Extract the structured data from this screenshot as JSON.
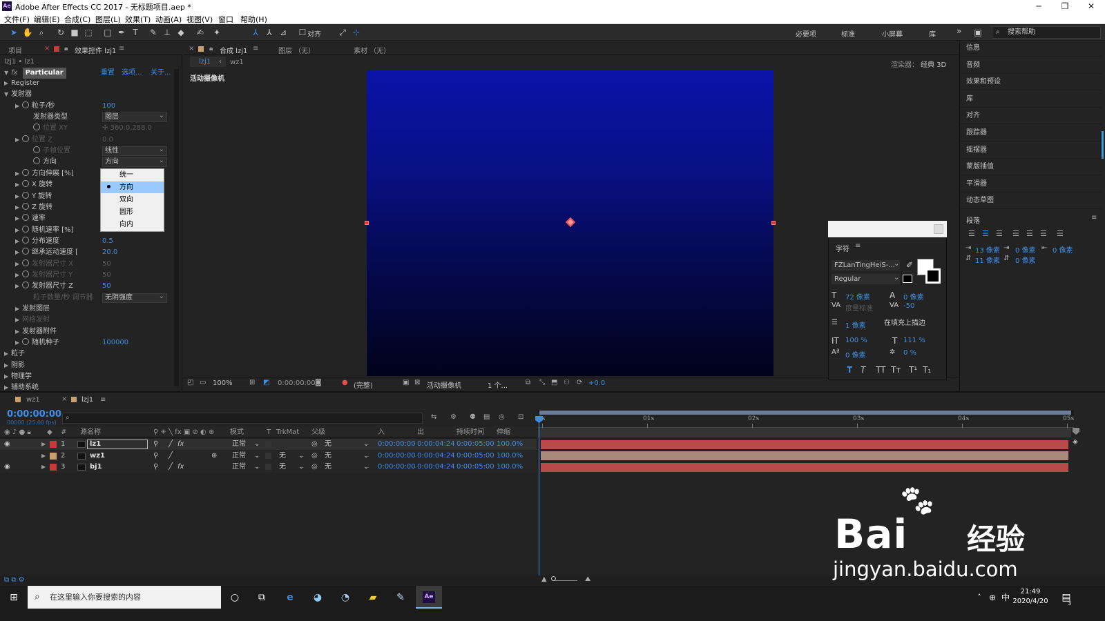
{
  "window": {
    "title": "Adobe After Effects CC 2017 - 无标题项目.aep *",
    "app_icon": "Ae",
    "min": "─",
    "max": "❐",
    "close": "✕"
  },
  "menu": [
    "文件(F)",
    "编辑(E)",
    "合成(C)",
    "图层(L)",
    "效果(T)",
    "动画(A)",
    "视图(V)",
    "窗口",
    "帮助(H)"
  ],
  "toolbar": {
    "align_label": "对齐",
    "workspaces": [
      "必要项",
      "标准",
      "小屏幕",
      "库"
    ],
    "more": "»",
    "search_help": "搜索帮助"
  },
  "effects_panel": {
    "tab_project": "项目",
    "tab_effects": "效果控件 lzj1",
    "menu_icon": "≡",
    "breadcrumb": "lzj1 • lz1",
    "fx_label": "fx",
    "effect_name": "Particular",
    "links": [
      "重置",
      "选项...",
      "关于..."
    ],
    "rows": [
      {
        "t": "Register",
        "ind": 0,
        "tri": "▶"
      },
      {
        "t": "发射器",
        "ind": 0,
        "tri": "▼"
      },
      {
        "t": "粒子/秒",
        "ind": 1,
        "tri": "▶",
        "sw": true,
        "v": "100"
      },
      {
        "t": "发射器类型",
        "ind": 2,
        "dd": "图层"
      },
      {
        "t": "位置 XY",
        "ind": 2,
        "sw": true,
        "v": "✢ 360.0,288.0",
        "dim": true
      },
      {
        "t": "位置 Z",
        "ind": 1,
        "tri": "▶",
        "sw": true,
        "v": "0.0",
        "dim": true
      },
      {
        "t": "子帧位置",
        "ind": 2,
        "sw": true,
        "dd": "线性",
        "dim": true
      },
      {
        "t": "方向",
        "ind": 2,
        "sw": true,
        "dd": "方向"
      },
      {
        "t": "方向伸展 [%]",
        "ind": 1,
        "tri": "▶",
        "sw": true
      },
      {
        "t": "X 旋转",
        "ind": 1,
        "tri": "▶",
        "sw": true
      },
      {
        "t": "Y 旋转",
        "ind": 1,
        "tri": "▶",
        "sw": true
      },
      {
        "t": "Z 旋转",
        "ind": 1,
        "tri": "▶",
        "sw": true
      },
      {
        "t": "速率",
        "ind": 1,
        "tri": "▶",
        "sw": true
      },
      {
        "t": "随机速率 [%]",
        "ind": 1,
        "tri": "▶",
        "sw": true
      },
      {
        "t": "分布速度",
        "ind": 1,
        "tri": "▶",
        "sw": true,
        "v": "0.5"
      },
      {
        "t": "继承运动速度 [",
        "ind": 1,
        "tri": "▶",
        "sw": true,
        "v": "20.0"
      },
      {
        "t": "发射器尺寸 X",
        "ind": 1,
        "tri": "▶",
        "sw": true,
        "v": "50",
        "dim": true
      },
      {
        "t": "发射器尺寸 Y",
        "ind": 1,
        "tri": "▶",
        "sw": true,
        "v": "50",
        "dim": true
      },
      {
        "t": "发射器尺寸 Z",
        "ind": 1,
        "tri": "▶",
        "sw": true,
        "v": "50"
      },
      {
        "t": "粒子数量/秒 调节器",
        "ind": 2,
        "dd": "无阴强度",
        "dim": true
      },
      {
        "t": "发射图层",
        "ind": 1,
        "tri": "▶"
      },
      {
        "t": "网格发射",
        "ind": 1,
        "tri": "▶",
        "dim": true
      },
      {
        "t": "发射器附件",
        "ind": 1,
        "tri": "▶"
      },
      {
        "t": "随机种子",
        "ind": 1,
        "tri": "▶",
        "sw": true,
        "v": "100000"
      },
      {
        "t": "粒子",
        "ind": 0,
        "tri": "▶"
      },
      {
        "t": "阴影",
        "ind": 0,
        "tri": "▶"
      },
      {
        "t": "物理学",
        "ind": 0,
        "tri": "▶"
      },
      {
        "t": "辅助系统",
        "ind": 0,
        "tri": "▶"
      }
    ],
    "popup": {
      "options": [
        "统一",
        "方向",
        "双向",
        "圆形",
        "向内"
      ],
      "selected": 1
    }
  },
  "comp_panel": {
    "tab_comp": "合成 lzj1",
    "tab_layer": "图层 （无）",
    "tab_footage": "素材 （无）",
    "sub_tabs": [
      "lzj1",
      "wz1"
    ],
    "renderer": "渲染器：",
    "renderer_val": "经典 3D",
    "camera_label": "活动摄像机",
    "bottom": {
      "zoom": "100%",
      "time": "0:00:00:00",
      "res": "(完整)",
      "camera": "活动摄像机",
      "views": "1 个...",
      "exposure": "+0.0"
    }
  },
  "right_panels": [
    "信息",
    "音频",
    "效果和预设",
    "库",
    "对齐",
    "跟踪器",
    "摇摆器",
    "蒙版插值",
    "平滑器",
    "动态草图"
  ],
  "paragraph": {
    "title": "段落",
    "indent": [
      "13 像素",
      "0 像素",
      "0 像素"
    ],
    "space": [
      "11 像素",
      "0 像素"
    ]
  },
  "character": {
    "title": "字符",
    "font": "FZLanTingHeiS-...",
    "style": "Regular",
    "size": "72 像素",
    "leading": "0 像素",
    "kerning": "度量标准",
    "tracking": "-50",
    "stroke": "1 像素",
    "stroke_mode": "在填充上描边",
    "vscale": "100 %",
    "hscale": "111 %",
    "baseline": "0 像素",
    "tsume": "0 %",
    "styles": [
      "T",
      "T",
      "TT",
      "Tт",
      "T¹",
      "T₁"
    ]
  },
  "timeline": {
    "tabs": [
      "wz1",
      "lzj1"
    ],
    "timecode": "0:00:00:00",
    "fps": "00000 (25.00 fps)",
    "headers": {
      "num": "#",
      "name": "源名称",
      "mode": "模式",
      "t": "T",
      "trkmat": "TrkMat",
      "parent": "父级",
      "in": "入",
      "out": "出",
      "dur": "持续时间",
      "stretch": "伸缩"
    },
    "ruler": [
      "0s",
      "01s",
      "02s",
      "03s",
      "04s",
      "05s"
    ],
    "layers": [
      {
        "n": "1",
        "name": "lz1",
        "color": "#c83a3a",
        "mode": "正常",
        "trk": "",
        "parent": "无",
        "in": "0:00:00:00",
        "out": "0:00:04:24",
        "dur": "0:00:05:00",
        "st": "100.0%",
        "bar": "#b84a4a",
        "fx": "fx"
      },
      {
        "n": "2",
        "name": "wz1",
        "color": "#c8a070",
        "mode": "正常",
        "trk": "无",
        "parent": "无",
        "in": "0:00:00:00",
        "out": "0:00:04:24",
        "dur": "0:00:05:00",
        "st": "100.0%",
        "bar": "#a98a7a",
        "fx": ""
      },
      {
        "n": "3",
        "name": "bj1",
        "color": "#c83a3a",
        "mode": "正常",
        "trk": "无",
        "parent": "无",
        "in": "0:00:00:00",
        "out": "0:00:04:24",
        "dur": "0:00:05:00",
        "st": "100.0%",
        "bar": "#b84a4a",
        "fx": "fx"
      }
    ]
  },
  "taskbar": {
    "search": "在这里输入你要搜索的内容",
    "time": "21:49",
    "date": "2020/4/20",
    "ime": "中",
    "notif": "3"
  },
  "watermark": {
    "brand": "Bai",
    "brand_cn": "经验",
    "url": "jingyan.baidu.com"
  }
}
